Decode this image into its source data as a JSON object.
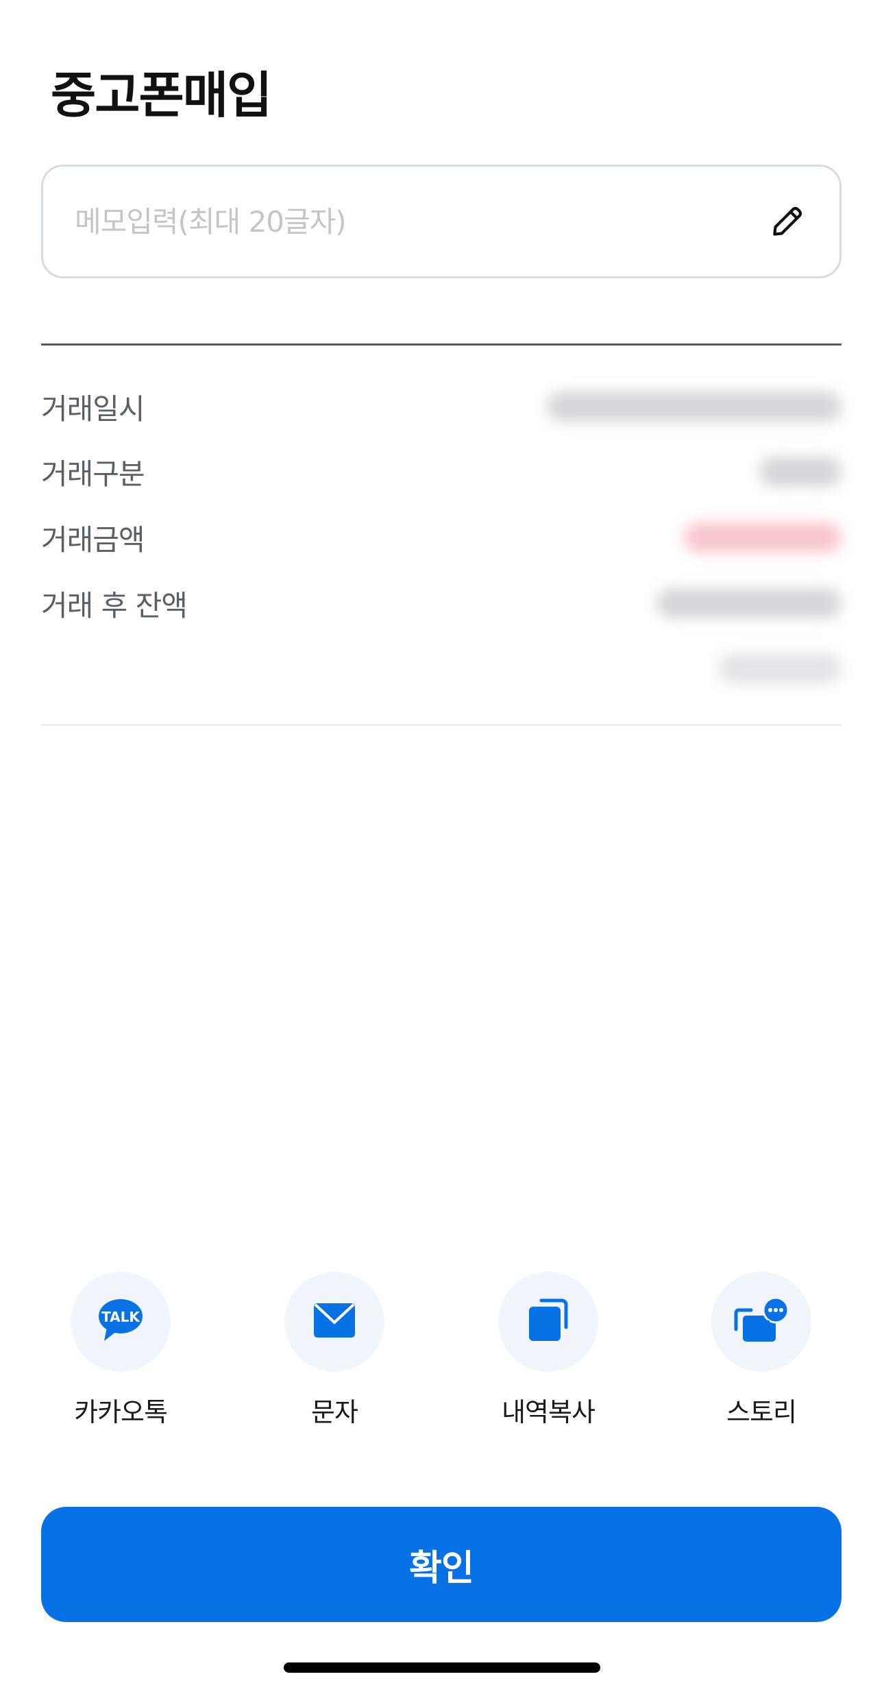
{
  "header": {
    "title": "중고폰매입"
  },
  "memo": {
    "value": "",
    "placeholder": "메모입력(최대 20글자)",
    "icon": "pencil-icon"
  },
  "details": {
    "rows": [
      {
        "label": "거래일시",
        "value": "[redacted]"
      },
      {
        "label": "거래구분",
        "value": "[redacted]"
      },
      {
        "label": "거래금액",
        "value": "[redacted]"
      },
      {
        "label": "거래 후 잔액",
        "value": "[redacted]"
      },
      {
        "label": "",
        "value": "[redacted]"
      }
    ]
  },
  "share": {
    "items": [
      {
        "label": "카카오톡",
        "icon": "kakaotalk-icon"
      },
      {
        "label": "문자",
        "icon": "message-icon"
      },
      {
        "label": "내역복사",
        "icon": "copy-icon"
      },
      {
        "label": "스토리",
        "icon": "story-icon"
      }
    ]
  },
  "footer": {
    "confirm_label": "확인"
  },
  "colors": {
    "accent": "#0971e6",
    "icon_bg": "#f1f5fb",
    "amount_highlight": "#f7c6cd",
    "label_gray": "#5a5e66"
  }
}
